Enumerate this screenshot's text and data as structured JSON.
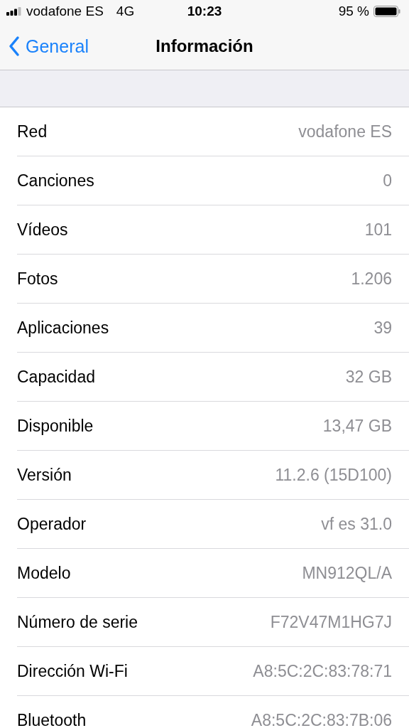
{
  "status_bar": {
    "carrier": "vodafone ES",
    "network": "4G",
    "time": "10:23",
    "battery": "95 %"
  },
  "nav": {
    "back": "General",
    "title": "Información"
  },
  "rows": [
    {
      "label": "Red",
      "value": "vodafone ES"
    },
    {
      "label": "Canciones",
      "value": "0"
    },
    {
      "label": "Vídeos",
      "value": "101"
    },
    {
      "label": "Fotos",
      "value": "1.206"
    },
    {
      "label": "Aplicaciones",
      "value": "39"
    },
    {
      "label": "Capacidad",
      "value": "32 GB"
    },
    {
      "label": "Disponible",
      "value": "13,47 GB"
    },
    {
      "label": "Versión",
      "value": "11.2.6 (15D100)"
    },
    {
      "label": "Operador",
      "value": "vf es 31.0"
    },
    {
      "label": "Modelo",
      "value": "MN912QL/A"
    },
    {
      "label": "Número de serie",
      "value": "F72V47M1HG7J"
    },
    {
      "label": "Dirección Wi-Fi",
      "value": "A8:5C:2C:83:78:71"
    },
    {
      "label": "Bluetooth",
      "value": "A8:5C:2C:83:7B:06"
    }
  ]
}
